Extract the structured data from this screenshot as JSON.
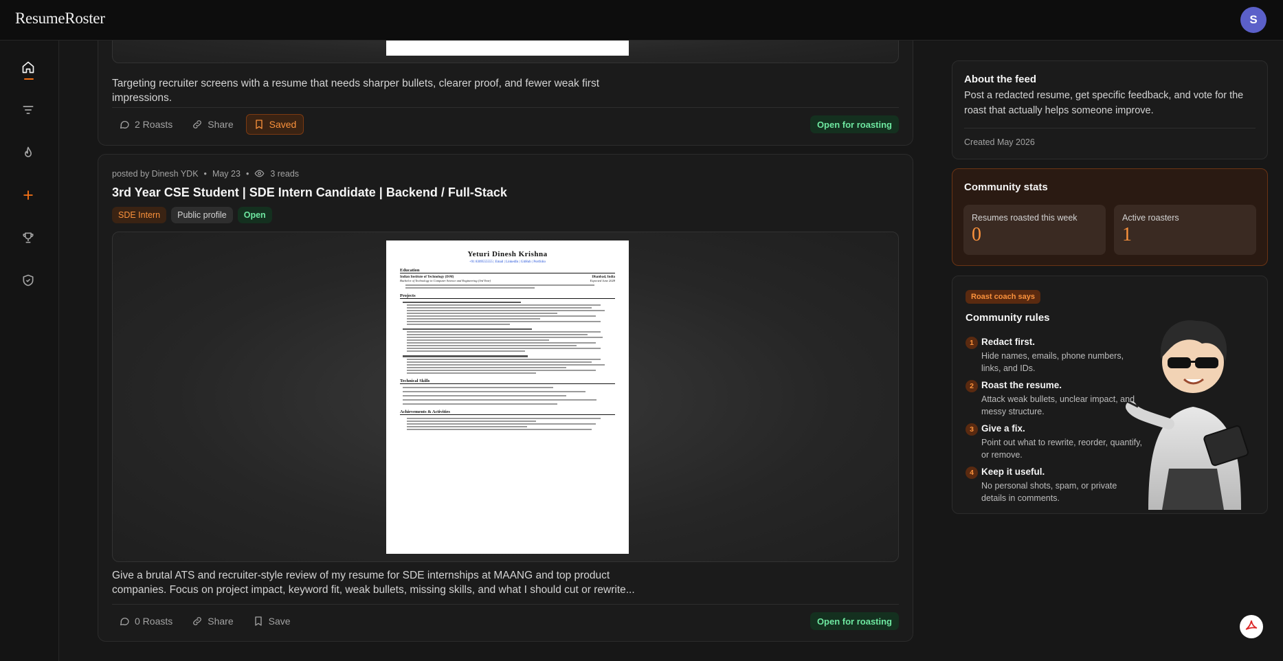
{
  "app": {
    "brand": "ResumeRoster",
    "avatar_initial": "S"
  },
  "rail": {
    "items": [
      "home-icon",
      "filter-icon",
      "flame-icon",
      "plus-icon",
      "trophy-icon",
      "shield-check-icon"
    ]
  },
  "posts": [
    {
      "description": "Targeting recruiter screens with a resume that needs sharper bullets, clearer proof, and fewer weak first impressions.",
      "actions": {
        "roasts": "2 Roasts",
        "share": "Share",
        "save": "Saved"
      },
      "status": "Open for roasting"
    },
    {
      "author": "posted by Dinesh YDK",
      "date": "May 23",
      "reads": "3 reads",
      "title": "3rd Year CSE Student | SDE Intern Candidate | Backend / Full-Stack",
      "tags": [
        "SDE Intern",
        "Public profile",
        "Open"
      ],
      "description": "Give a brutal ATS and recruiter-style review of my resume for SDE internships at MAANG and top product companies. Focus on project impact, keyword fit, weak bullets, missing skills, and what I should cut or rewrite...",
      "actions": {
        "roasts": "0 Roasts",
        "share": "Share",
        "save": "Save"
      },
      "status": "Open for roasting",
      "resume": {
        "name": "Yeturi Dinesh Krishna",
        "contact": "+91 8309555555 | Email | LinkedIn | GitHub | Portfolio",
        "sections": [
          "Education",
          "Projects",
          "Technical Skills",
          "Achievements & Activities"
        ],
        "school": "Indian Institute of Technology (ISM)",
        "location": "Dhanbad, India",
        "degree": "Bachelor of Technology in Computer Science and Engineering (3rd Year)",
        "expected": "Expected June 2028"
      }
    }
  ],
  "about": {
    "title": "About the feed",
    "text": "Post a redacted resume, get specific feedback, and vote for the roast that actually helps someone improve.",
    "created": "Created May 2026"
  },
  "stats": {
    "title": "Community stats",
    "items": [
      {
        "label": "Resumes roasted this week",
        "value": "0"
      },
      {
        "label": "Active roasters",
        "value": "1"
      }
    ]
  },
  "rules": {
    "badge": "Roast coach says",
    "title": "Community rules",
    "items": [
      {
        "num": "1",
        "title": "Redact first.",
        "desc": "Hide names, emails, phone numbers, links, and IDs."
      },
      {
        "num": "2",
        "title": "Roast the resume.",
        "desc": "Attack weak bullets, unclear impact, and messy structure."
      },
      {
        "num": "3",
        "title": "Give a fix.",
        "desc": "Point out what to rewrite, reorder, quantify, or remove."
      },
      {
        "num": "4",
        "title": "Keep it useful.",
        "desc": "No personal shots, spam, or private details in comments."
      }
    ]
  },
  "colors": {
    "accent": "#f97316",
    "success": "#6ee7a0",
    "avatar": "#5b60c9"
  }
}
